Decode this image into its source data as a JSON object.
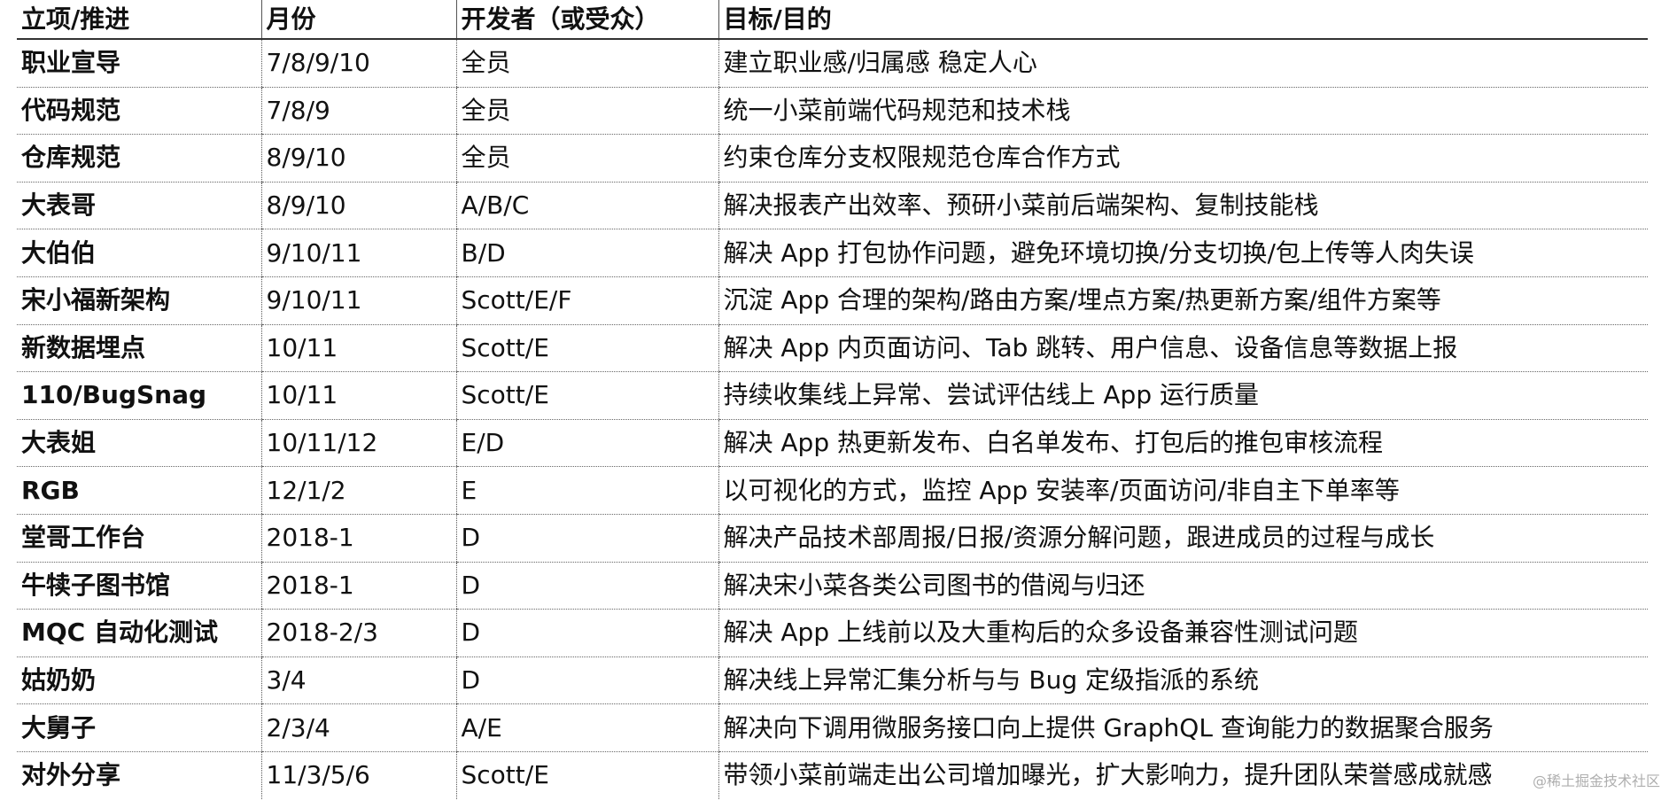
{
  "table": {
    "headers": [
      "立项/推进",
      "月份",
      "开发者（或受众）",
      "目标/目的"
    ],
    "rows": [
      [
        "职业宣导",
        "7/8/9/10",
        "全员",
        "建立职业感/归属感 稳定人心"
      ],
      [
        "代码规范",
        "7/8/9",
        "全员",
        "统一小菜前端代码规范和技术栈"
      ],
      [
        "仓库规范",
        "8/9/10",
        "全员",
        "约束仓库分支权限规范仓库合作方式"
      ],
      [
        "大表哥",
        "8/9/10",
        "A/B/C",
        "解决报表产出效率、预研小菜前后端架构、复制技能栈"
      ],
      [
        "大伯伯",
        "9/10/11",
        "B/D",
        "解决 App 打包协作问题，避免环境切换/分支切换/包上传等人肉失误"
      ],
      [
        "宋小福新架构",
        "9/10/11",
        "Scott/E/F",
        "沉淀 App 合理的架构/路由方案/埋点方案/热更新方案/组件方案等"
      ],
      [
        "新数据埋点",
        "10/11",
        "Scott/E",
        "解决 App 内页面访问、Tab 跳转、用户信息、设备信息等数据上报"
      ],
      [
        "110/BugSnag",
        "10/11",
        "Scott/E",
        "持续收集线上异常、尝试评估线上 App 运行质量"
      ],
      [
        "大表姐",
        "10/11/12",
        "E/D",
        "解决 App 热更新发布、白名单发布、打包后的推包审核流程"
      ],
      [
        "RGB",
        "12/1/2",
        "E",
        "以可视化的方式，监控 App 安装率/页面访问/非自主下单率等"
      ],
      [
        "堂哥工作台",
        "2018-1",
        "D",
        "解决产品技术部周报/日报/资源分解问题，跟进成员的过程与成长"
      ],
      [
        "牛犊子图书馆",
        "2018-1",
        "D",
        "解决宋小菜各类公司图书的借阅与归还"
      ],
      [
        "MQC 自动化测试",
        "2018-2/3",
        "D",
        "解决 App 上线前以及大重构后的众多设备兼容性测试问题"
      ],
      [
        "姑奶奶",
        "3/4",
        "D",
        "解决线上异常汇集分析与与 Bug 定级指派的系统"
      ],
      [
        "大舅子",
        "2/3/4",
        "A/E",
        "解决向下调用微服务接口向上提供 GraphQL 查询能力的数据聚合服务"
      ],
      [
        "对外分享",
        "11/3/5/6",
        "Scott/E",
        "带领小菜前端走出公司增加曝光，扩大影响力，提升团队荣誉感成就感"
      ]
    ]
  },
  "watermark": "@稀土掘金技术社区"
}
